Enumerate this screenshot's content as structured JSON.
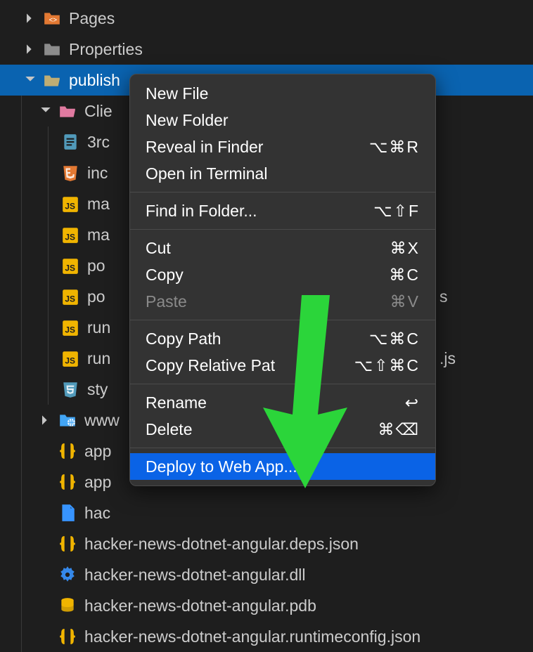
{
  "tree": {
    "pages": "Pages",
    "properties": "Properties",
    "publish": "publish",
    "client": "Clie",
    "third": "3rc",
    "inc": "inc",
    "mar1": "ma",
    "mar2": "ma",
    "po1": "po",
    "po2": "po",
    "run1": "run",
    "run2": "run",
    "sty": "sty",
    "www": "www",
    "apps1": "app",
    "apps2": "app",
    "hac": "hac",
    "depsjson": "hacker-news-dotnet-angular.deps.json",
    "dll": "hacker-news-dotnet-angular.dll",
    "pdb": "hacker-news-dotnet-angular.pdb",
    "rtjson": "hacker-news-dotnet-angular.runtimeconfig.json",
    "tail_s": "s",
    "tail_js": ".js"
  },
  "menu": {
    "newfile": "New File",
    "newfolder": "New Folder",
    "reveal": "Reveal in Finder",
    "reveal_k": "⌥⌘R",
    "openterm": "Open in Terminal",
    "find": "Find in Folder...",
    "find_k": "⌥⇧F",
    "cut": "Cut",
    "cut_k": "⌘X",
    "copy": "Copy",
    "copy_k": "⌘C",
    "paste": "Paste",
    "paste_k": "⌘V",
    "copypath": "Copy Path",
    "copypath_k": "⌥⌘C",
    "copyrel": "Copy Relative Pat",
    "copyrel_k": "⌥⇧⌘C",
    "rename": "Rename",
    "rename_k": "↩",
    "delete": "Delete",
    "delete_k": "⌘⌫",
    "deploy": "Deploy to Web App..."
  }
}
